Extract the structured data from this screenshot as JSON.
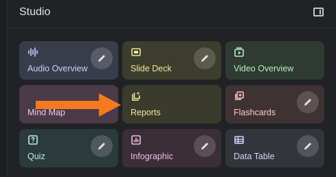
{
  "studio": {
    "title": "Studio",
    "panel_toggle_icon": "side-panel-icon"
  },
  "cards": [
    {
      "id": "audio",
      "label": "Audio Overview",
      "icon": "audio-waveform-icon",
      "bg": "#393d4b",
      "fg": "#c5d2ff",
      "edit": true
    },
    {
      "id": "slide",
      "label": "Slide Deck",
      "icon": "slides-icon",
      "bg": "#3c3d2d",
      "fg": "#f1e69a",
      "edit": true
    },
    {
      "id": "video",
      "label": "Video Overview",
      "icon": "video-icon",
      "bg": "#2f3a32",
      "fg": "#b7eec1",
      "edit": false
    },
    {
      "id": "mindmap",
      "label": "Mind Map",
      "icon": "mind-map-icon",
      "bg": "#4b3a48",
      "fg": "#f4c4ea",
      "edit": false
    },
    {
      "id": "reports",
      "label": "Reports",
      "icon": "reports-icon",
      "bg": "#3a3b2c",
      "fg": "#f2e8a3",
      "edit": false
    },
    {
      "id": "flash",
      "label": "Flashcards",
      "icon": "flashcards-icon",
      "bg": "#3e3233",
      "fg": "#ffc9c3",
      "edit": true
    },
    {
      "id": "quiz",
      "label": "Quiz",
      "icon": "quiz-icon",
      "bg": "#2b3a3b",
      "fg": "#c4ecf0",
      "edit": true
    },
    {
      "id": "info",
      "label": "Infographic",
      "icon": "infographic-icon",
      "bg": "#3b2e37",
      "fg": "#f5bce2",
      "edit": true
    },
    {
      "id": "table",
      "label": "Data Table",
      "icon": "table-icon",
      "bg": "#33353d",
      "fg": "#cdd6f5",
      "edit": true
    }
  ],
  "annotation": {
    "arrow_color": "#f47a1f",
    "arrow_icon": "orange-arrow-icon"
  }
}
